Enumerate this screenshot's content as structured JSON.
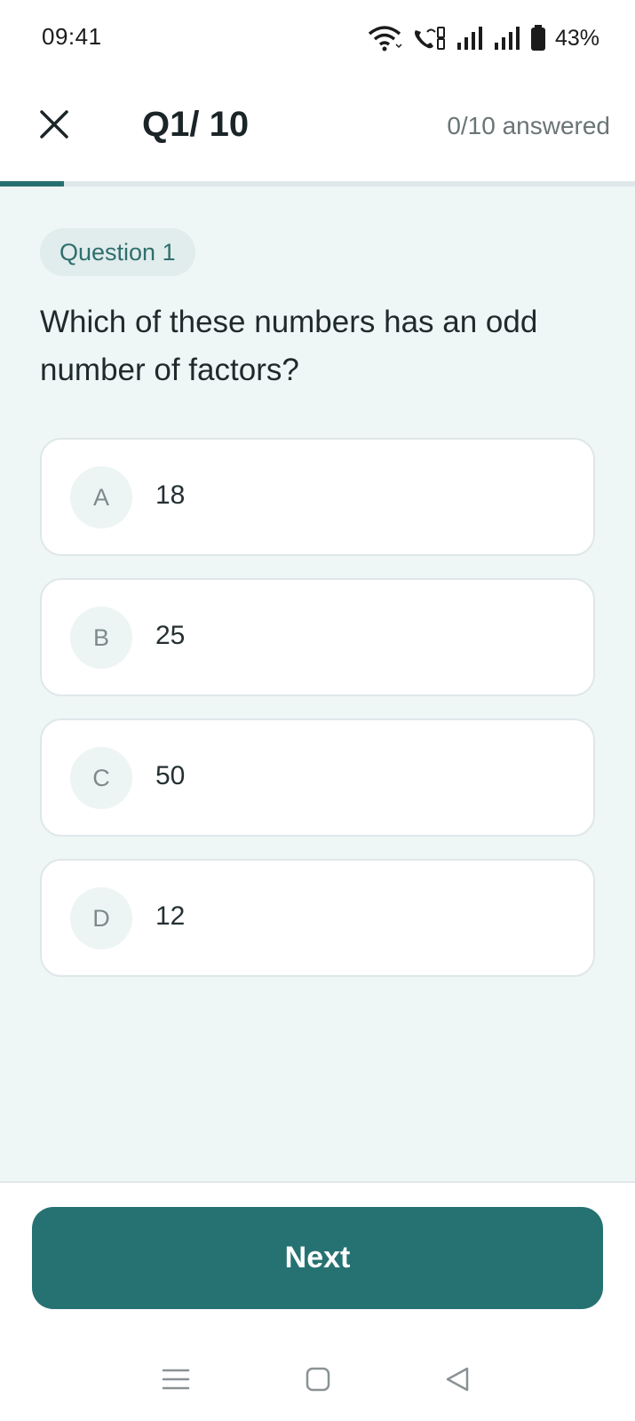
{
  "status_bar": {
    "time": "09:41",
    "battery": "43%",
    "icons": [
      "wifi-icon",
      "volte-call-icon",
      "signal-icon-sim1",
      "signal-icon-sim2",
      "battery-icon"
    ]
  },
  "header": {
    "close_icon": "close-icon",
    "question_counter": "Q1/ 10",
    "answered_status": "0/10 answered"
  },
  "progress": {
    "answered": 0,
    "total": 10,
    "fraction": 0.1
  },
  "question": {
    "tag": "Question 1",
    "text": "Which of these numbers has an odd number of factors?"
  },
  "options": [
    {
      "letter": "A",
      "text": "18"
    },
    {
      "letter": "B",
      "text": "25"
    },
    {
      "letter": "C",
      "text": "50"
    },
    {
      "letter": "D",
      "text": "12"
    }
  ],
  "next_label": "Next",
  "nav_bar": {
    "icons": [
      "recent-apps-icon",
      "home-icon",
      "back-icon"
    ]
  },
  "colors": {
    "accent": "#267272",
    "background": "#eff6f6",
    "card": "#ffffff",
    "track": "#dfe7ea"
  }
}
